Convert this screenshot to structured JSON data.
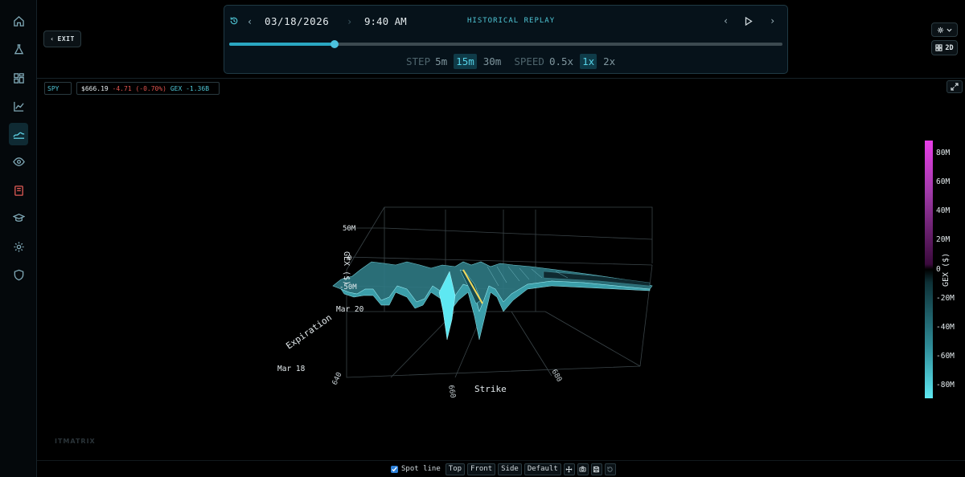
{
  "nav": {
    "exit_label": "EXIT"
  },
  "replay": {
    "date": "03/18/2026",
    "time": "9:40 AM",
    "title": "HISTORICAL REPLAY",
    "progress": 0.19,
    "step_label": "STEP",
    "steps": [
      "5m",
      "15m",
      "30m"
    ],
    "selected_step": "15m",
    "speed_label": "SPEED",
    "speeds": [
      "0.5x",
      "1x",
      "2x"
    ],
    "selected_speed": "1x"
  },
  "view_toggle": {
    "label": "2D"
  },
  "ticker": {
    "symbol": "SPY",
    "price": "$666.19",
    "change": "-4.71",
    "change_pct": "(-0.70%)",
    "gex_label": "GEX",
    "gex_value": "-1.36B"
  },
  "plot": {
    "z_title": "GEX ($)",
    "z_ticks": [
      "50M",
      "0",
      "-50M"
    ],
    "y_title": "Expiration",
    "y_ticks": [
      "Mar 20",
      "Mar 18"
    ],
    "x_title": "Strike",
    "x_ticks": [
      "640",
      "660",
      "680"
    ]
  },
  "colorbar": {
    "title": "GEX ($)",
    "ticks": [
      "80M",
      "60M",
      "40M",
      "20M",
      "0",
      "-20M",
      "-40M",
      "-60M",
      "-80M"
    ]
  },
  "watermark": "ITMATRIX",
  "toolbar": {
    "spot_line_label": "Spot line",
    "spot_line_checked": true,
    "buttons": [
      "Top",
      "Front",
      "Side",
      "Default"
    ]
  },
  "colors": {
    "accent": "#4fc6d6",
    "negative": "#e0544f",
    "surface": "#5ee8f2",
    "positive": "#e83ee8"
  }
}
